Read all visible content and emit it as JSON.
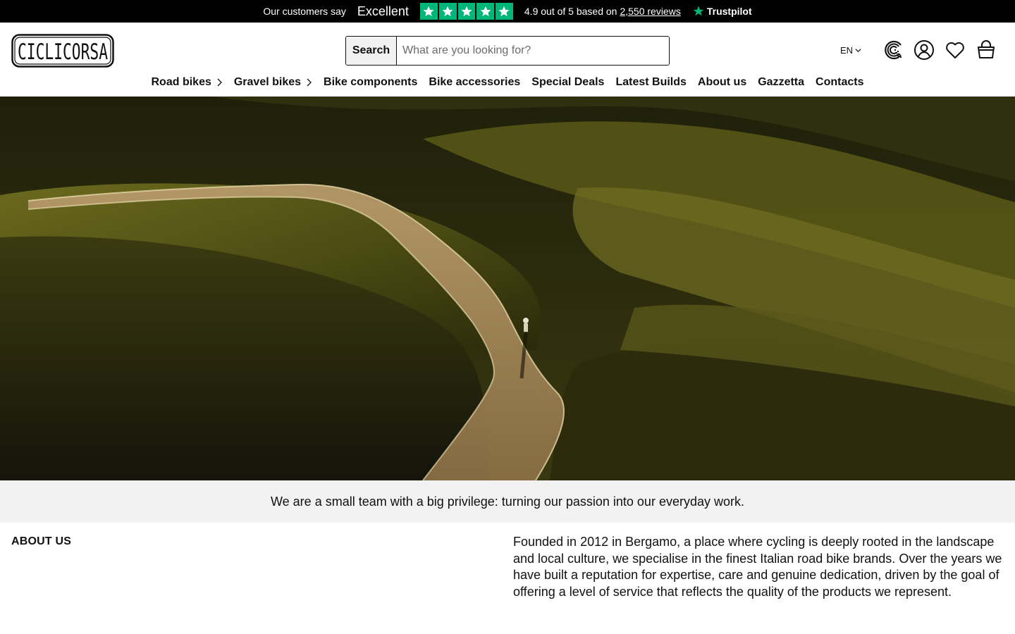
{
  "trustpilot": {
    "say": "Our customers say",
    "grade": "Excellent",
    "rating_text": "4.9 out of 5 based on",
    "reviews_link": "2,550 reviews",
    "brand": "Trustpilot",
    "stars_count": 5,
    "brand_color": "#00b67a"
  },
  "header": {
    "logo_text": "CICLICORSA",
    "search": {
      "button_label": "Search",
      "placeholder": "What are you looking for?",
      "value": ""
    },
    "language": "EN",
    "icons": [
      "rewards-icon",
      "account-icon",
      "wishlist-icon",
      "cart-icon"
    ]
  },
  "nav": {
    "items": [
      {
        "label": "Road bikes",
        "has_submenu": true
      },
      {
        "label": "Gravel bikes",
        "has_submenu": true
      },
      {
        "label": "Bike components",
        "has_submenu": false
      },
      {
        "label": "Bike accessories",
        "has_submenu": false
      },
      {
        "label": "Special Deals",
        "has_submenu": false
      },
      {
        "label": "Latest Builds",
        "has_submenu": false
      },
      {
        "label": "About us",
        "has_submenu": false
      },
      {
        "label": "Gazzetta",
        "has_submenu": false
      },
      {
        "label": "Contacts",
        "has_submenu": false
      }
    ]
  },
  "tagline": "We are a small team with a big privilege: turning our passion into our everyday work.",
  "about": {
    "title": "ABOUT US",
    "text": "Founded in 2012 in Bergamo, a place where cycling is deeply rooted in the landscape and local culture, we specialise in the finest Italian road bike brands. Over the years we have built a reputation for expertise, care and genuine dedication, driven by the goal of offering a level of service that reflects the quality of the products we represent."
  }
}
